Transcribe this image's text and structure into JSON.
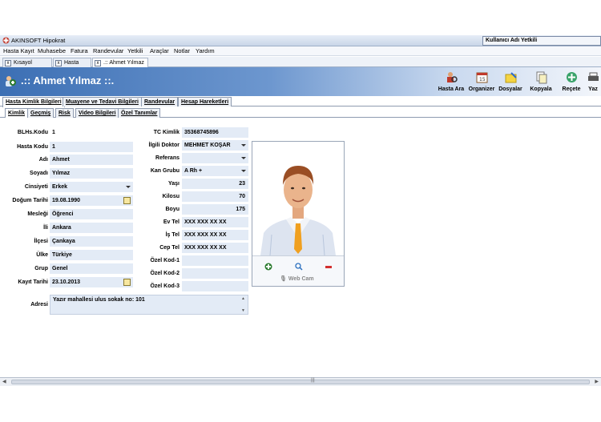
{
  "window": {
    "title": "AKINSOFT Hipokrat",
    "user_field": "Kullanıcı Adı Yetkili"
  },
  "menu": [
    "Hasta Kayıt",
    "Muhasebe",
    "Fatura",
    "Randevular",
    "Yetkili",
    "Araçlar",
    "Notlar",
    "Yardım"
  ],
  "doc_tabs": [
    "Kısayol Çubuğu",
    "Hasta Arama",
    ".:: Ahmet Yılmaz ::."
  ],
  "header": {
    "patient_title": ".:: Ahmet Yılmaz ::."
  },
  "toolbar": [
    {
      "label": "Hasta Ara",
      "icon": "search-patient-icon"
    },
    {
      "label": "Organizer",
      "icon": "calendar-icon"
    },
    {
      "label": "Dosyalar",
      "icon": "folder-icon"
    },
    {
      "label": "Kopyala",
      "icon": "copy-icon"
    },
    {
      "label": "Reçete",
      "icon": "prescription-icon"
    },
    {
      "label": "Yaz",
      "icon": "print-icon"
    }
  ],
  "main_tabs": [
    "Hasta Kimlik Bilgileri",
    "Muayene ve Tedavi Bilgileri",
    "Randevular",
    "Hesap Hareketleri"
  ],
  "sub_tabs": [
    "Kimlik",
    "Geçmiş",
    "Risk",
    "Video Bilgileri",
    "Özel Tanımlar"
  ],
  "form_left": [
    {
      "label": "BLHs.Kodu",
      "value": "1"
    },
    {
      "label": "Hasta Kodu",
      "value": "1"
    },
    {
      "label": "Adı",
      "value": "Ahmet"
    },
    {
      "label": "Soyadı",
      "value": "Yılmaz"
    },
    {
      "label": "Cinsiyeti",
      "value": "Erkek"
    },
    {
      "label": "Doğum Tarihi",
      "value": "19.08.1990"
    },
    {
      "label": "Mesleği",
      "value": "Öğrenci"
    },
    {
      "label": "İli",
      "value": "Ankara"
    },
    {
      "label": "İlçesi",
      "value": "Çankaya"
    },
    {
      "label": "Ülke",
      "value": "Türkiye"
    },
    {
      "label": "Grup",
      "value": "Genel"
    },
    {
      "label": "Kayıt Tarihi",
      "value": "23.10.2013"
    }
  ],
  "form_right": [
    {
      "label": "TC Kimlik",
      "value": "35368745896"
    },
    {
      "label": "İlgili Doktor",
      "value": "MEHMET KOŞAR"
    },
    {
      "label": "Referans",
      "value": ""
    },
    {
      "label": "Kan Grubu",
      "value": "A Rh +"
    },
    {
      "label": "Yaşı",
      "value": "23"
    },
    {
      "label": "Kilosu",
      "value": "70"
    },
    {
      "label": "Boyu",
      "value": "175"
    },
    {
      "label": "Ev Tel",
      "value": "XXX XXX XX XX"
    },
    {
      "label": "İş Tel",
      "value": "XXX XXX XX XX"
    },
    {
      "label": "Cep Tel",
      "value": "XXX XXX XX XX"
    },
    {
      "label": "Özel Kod-1",
      "value": ""
    },
    {
      "label": "Özel Kod-2",
      "value": ""
    },
    {
      "label": "Özel Kod-3",
      "value": ""
    }
  ],
  "address": {
    "label": "Adresi",
    "value": "Yazır mahallesi ulus sokak no: 101"
  },
  "photo": {
    "webcam_label": "Web Cam"
  }
}
